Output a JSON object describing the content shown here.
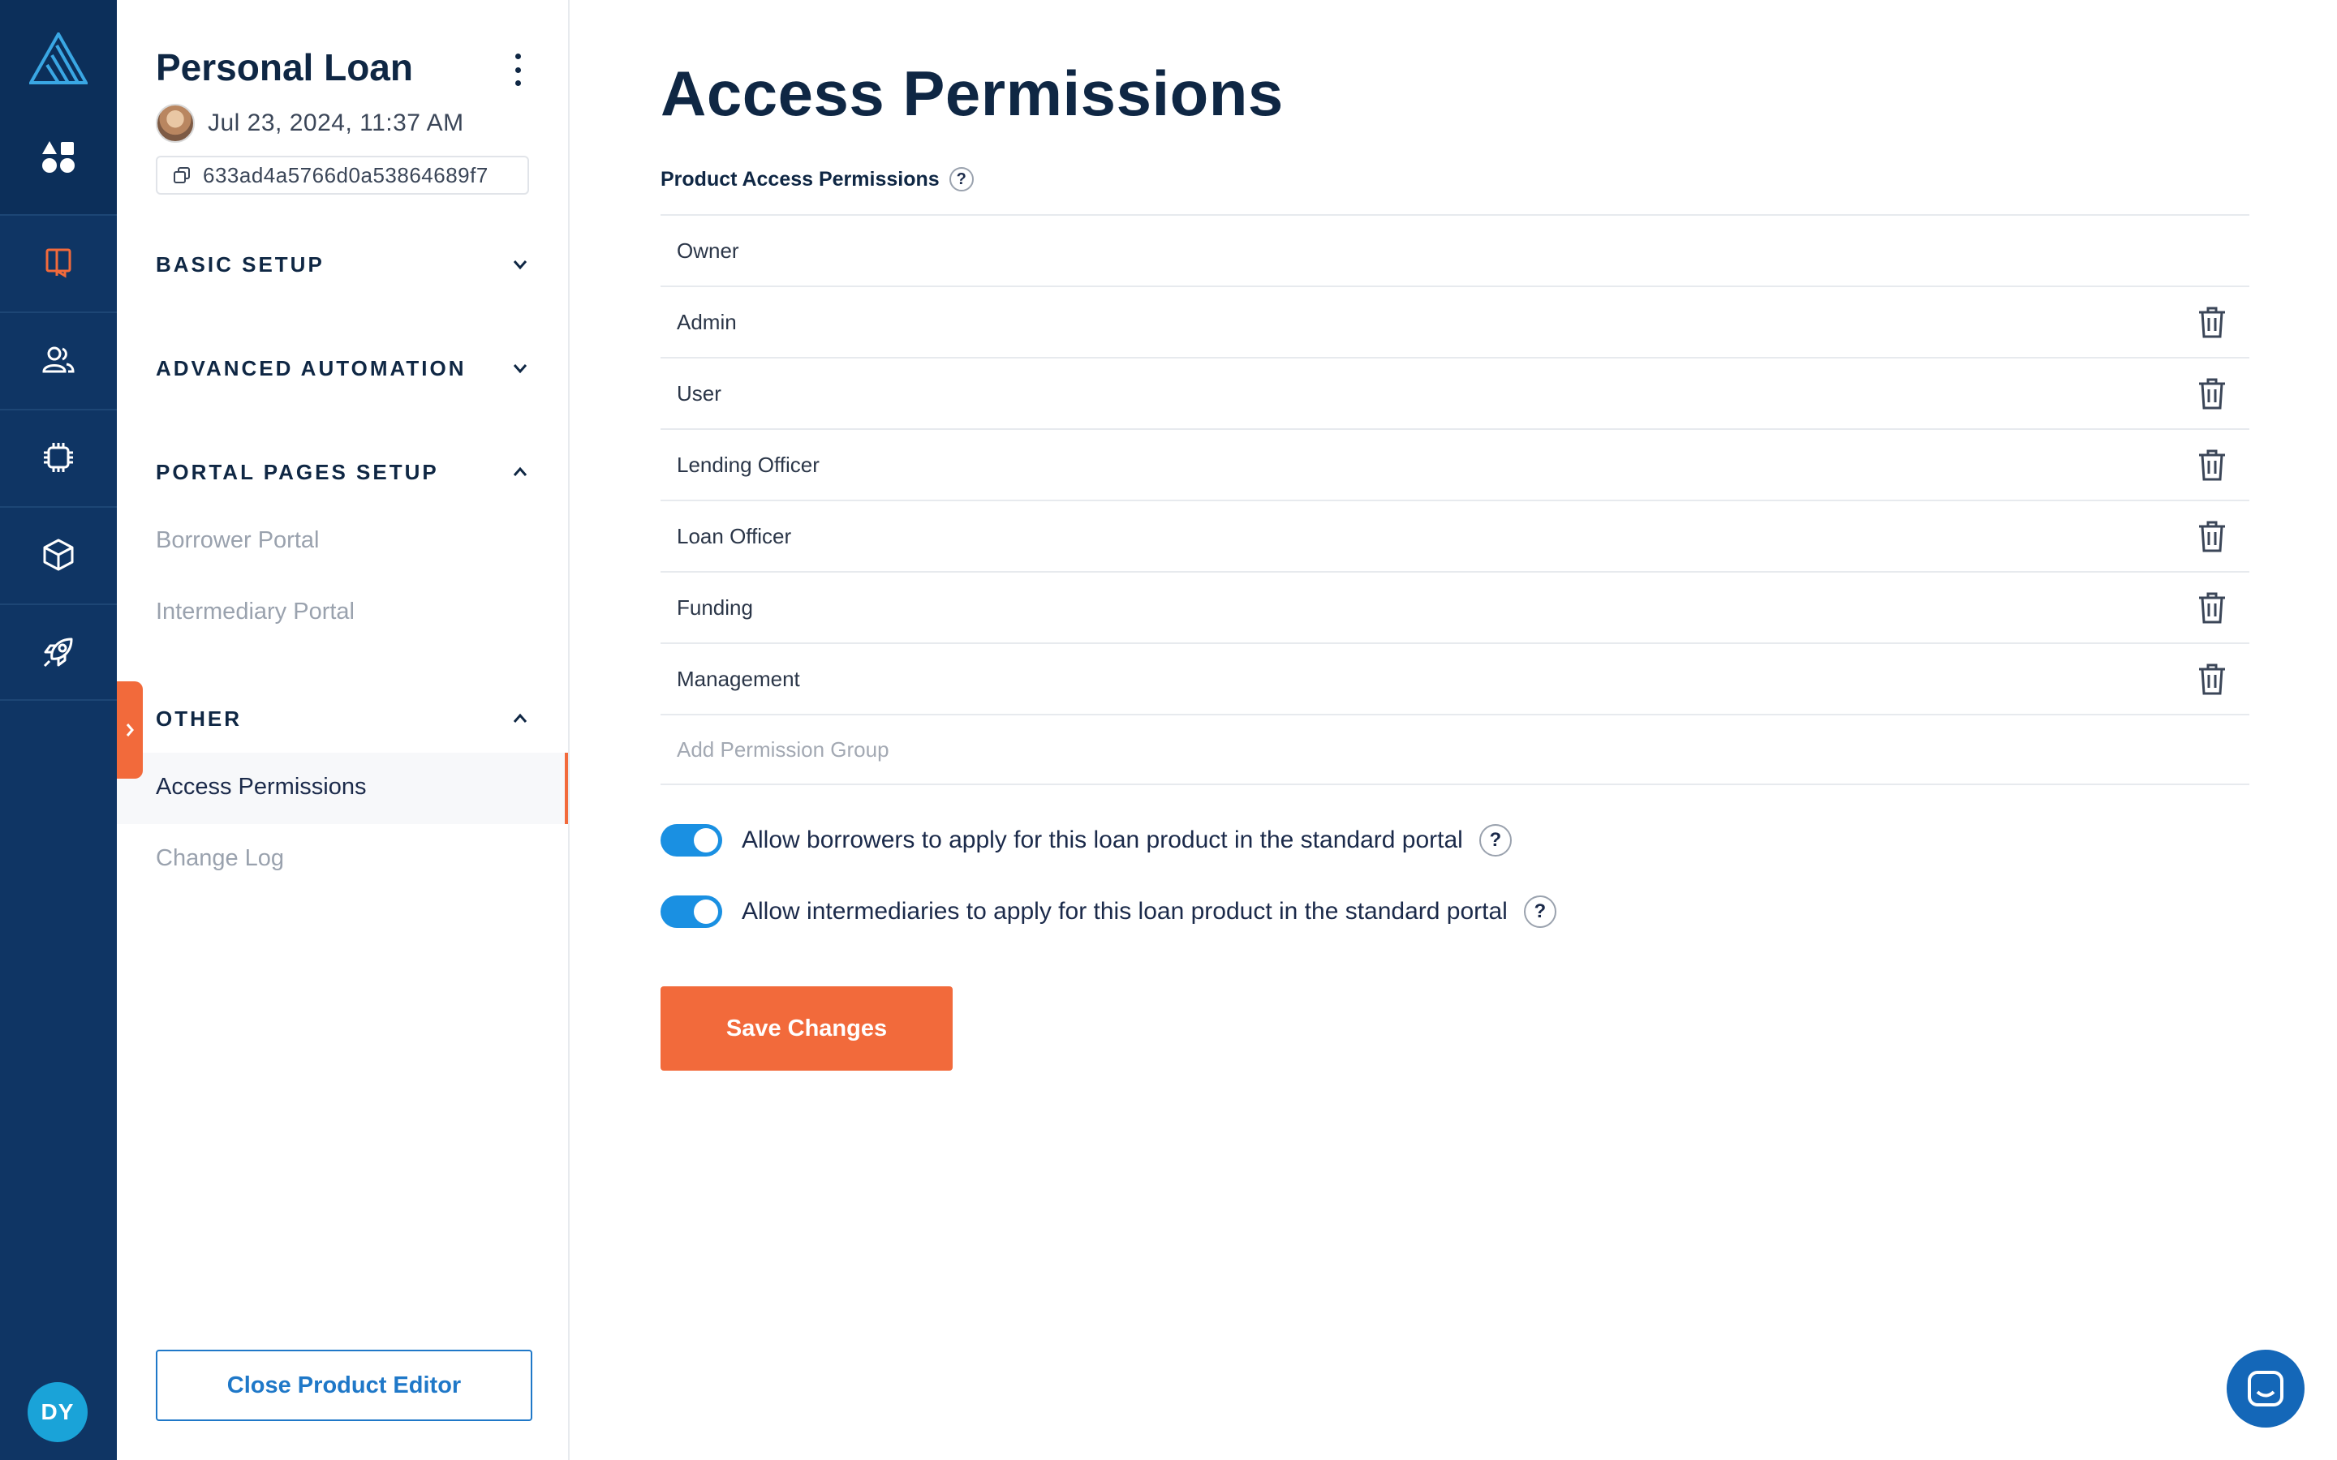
{
  "product": {
    "title": "Personal Loan",
    "date": "Jul 23, 2024, 11:37 AM",
    "id": "633ad4a5766d0a53864689f7"
  },
  "sidebar": {
    "sections": [
      {
        "label": "BASIC SETUP",
        "expanded": false
      },
      {
        "label": "ADVANCED AUTOMATION",
        "expanded": false
      },
      {
        "label": "PORTAL PAGES SETUP",
        "expanded": true,
        "items": [
          "Borrower Portal",
          "Intermediary Portal"
        ]
      },
      {
        "label": "OTHER",
        "expanded": true,
        "items": [
          "Access Permissions",
          "Change Log"
        ]
      }
    ],
    "active_item": "Access Permissions",
    "close_button": "Close Product Editor"
  },
  "rail": {
    "user_initials": "DY",
    "icons": [
      "apps-icon",
      "book-icon",
      "users-icon",
      "chip-icon",
      "cube-icon",
      "rocket-icon"
    ]
  },
  "main": {
    "title": "Access Permissions",
    "section_label": "Product Access Permissions",
    "help_glyph": "?",
    "permission_groups": [
      "Owner",
      "Admin",
      "User",
      "Lending Officer",
      "Loan Officer",
      "Funding",
      "Management"
    ],
    "add_placeholder": "Add Permission Group",
    "toggles": [
      {
        "label": "Allow borrowers to apply for this loan product in the standard portal",
        "on": true
      },
      {
        "label": "Allow intermediaries to apply for this loan product in the standard portal",
        "on": true
      }
    ],
    "save_button": "Save Changes"
  },
  "colors": {
    "rail": "#0f3564",
    "accent_orange": "#f26a3b",
    "toggle_blue": "#1a90e2",
    "link_blue": "#1f78c8"
  }
}
